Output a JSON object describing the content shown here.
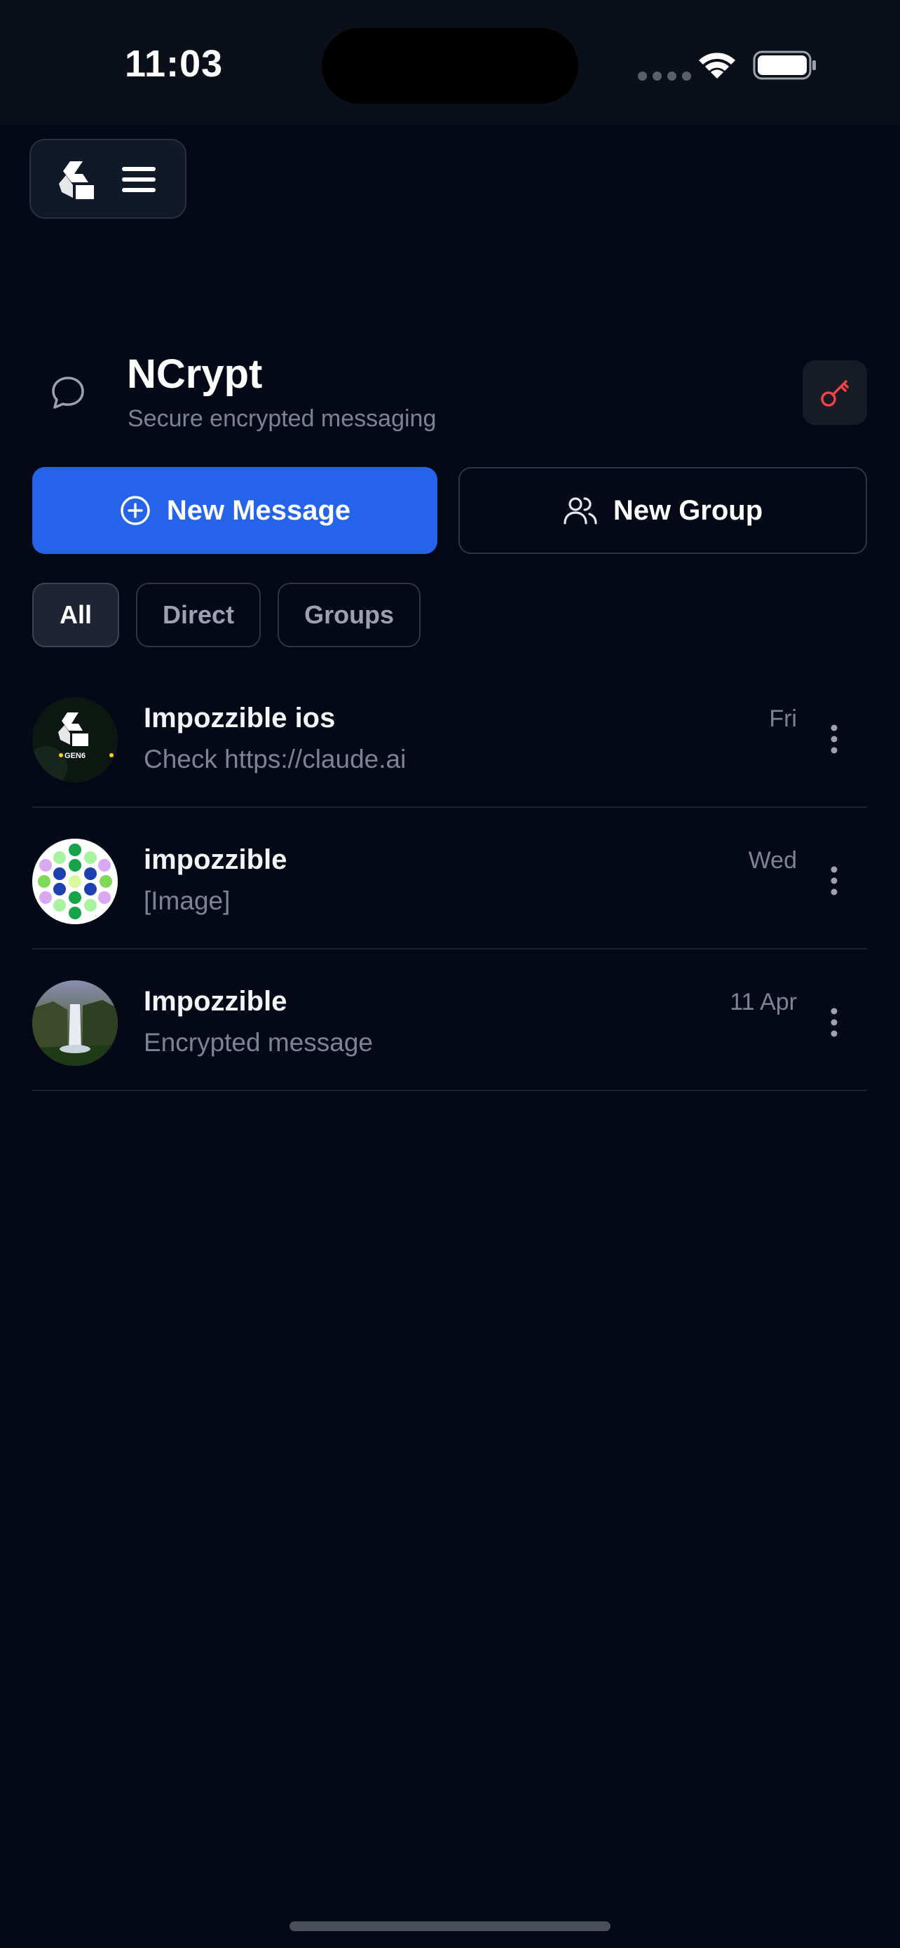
{
  "status_bar": {
    "time": "11:03"
  },
  "header": {
    "title": "NCrypt",
    "subtitle": "Secure encrypted messaging"
  },
  "actions": {
    "new_message": "New Message",
    "new_group": "New Group"
  },
  "filters": [
    {
      "label": "All",
      "active": true
    },
    {
      "label": "Direct",
      "active": false
    },
    {
      "label": "Groups",
      "active": false
    }
  ],
  "conversations": [
    {
      "name": "Impozzible ios",
      "preview": "Check https://claude.ai",
      "time": "Fri",
      "avatar_text": "GEN6"
    },
    {
      "name": "impozzible",
      "preview": "[Image]",
      "time": "Wed"
    },
    {
      "name": "Impozzible",
      "preview": "Encrypted message",
      "time": "11 Apr"
    }
  ],
  "colors": {
    "background": "#050816",
    "primary": "#2563eb",
    "key_icon": "#ef4444"
  },
  "icons": {
    "menu_logo": "app-logo-icon",
    "menu": "hamburger-icon",
    "chat": "chat-bubble-icon",
    "key": "key-icon",
    "new_message": "plus-circle-icon",
    "new_group": "users-icon",
    "row_menu": "more-vertical-icon"
  }
}
